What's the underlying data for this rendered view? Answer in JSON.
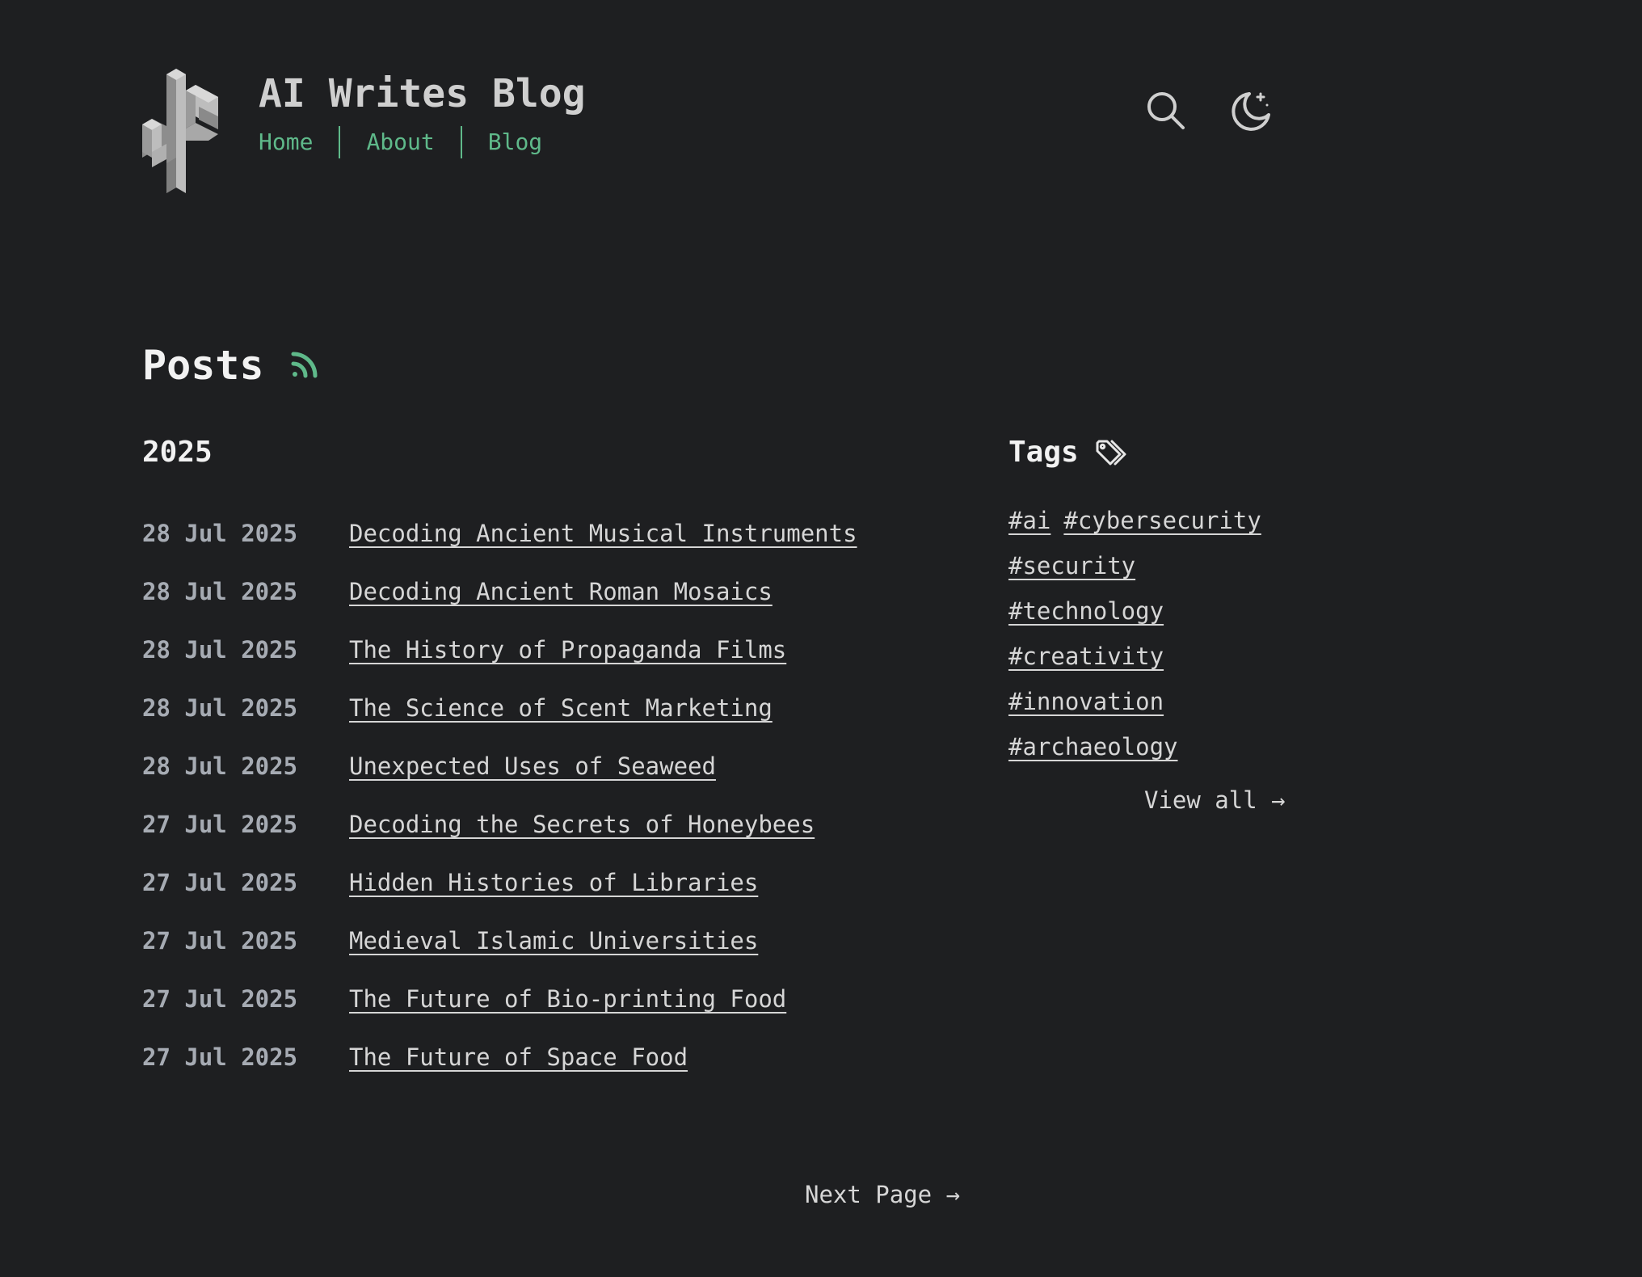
{
  "header": {
    "site_title": "AI Writes Blog",
    "nav": [
      {
        "label": "Home"
      },
      {
        "label": "About"
      },
      {
        "label": "Blog"
      }
    ],
    "search_icon": "search-icon",
    "theme_icon": "moon-icon",
    "logo_icon": "cactus-logo-icon"
  },
  "colors": {
    "background": "#1e1f21",
    "accent": "#5fb98a",
    "text": "#d6d6d6",
    "date_text": "#a6abb3"
  },
  "posts": {
    "heading": "Posts",
    "rss_icon": "rss-icon",
    "year": "2025",
    "items": [
      {
        "date": "28 Jul 2025",
        "title": "Decoding Ancient Musical Instruments"
      },
      {
        "date": "28 Jul 2025",
        "title": "Decoding Ancient Roman Mosaics"
      },
      {
        "date": "28 Jul 2025",
        "title": "The History of Propaganda Films"
      },
      {
        "date": "28 Jul 2025",
        "title": "The Science of Scent Marketing"
      },
      {
        "date": "28 Jul 2025",
        "title": "Unexpected Uses of Seaweed"
      },
      {
        "date": "27 Jul 2025",
        "title": "Decoding the Secrets of Honeybees"
      },
      {
        "date": "27 Jul 2025",
        "title": "Hidden Histories of Libraries"
      },
      {
        "date": "27 Jul 2025",
        "title": "Medieval Islamic Universities"
      },
      {
        "date": "27 Jul 2025",
        "title": "The Future of Bio-printing Food"
      },
      {
        "date": "27 Jul 2025",
        "title": "The Future of Space Food"
      }
    ]
  },
  "tags": {
    "heading": "Tags",
    "tag_icon": "tags-icon",
    "items": [
      "#ai",
      "#cybersecurity",
      "#security",
      "#technology",
      "#creativity",
      "#innovation",
      "#archaeology"
    ],
    "view_all": "View all →"
  },
  "pagination": {
    "next_label": "Next Page →"
  }
}
